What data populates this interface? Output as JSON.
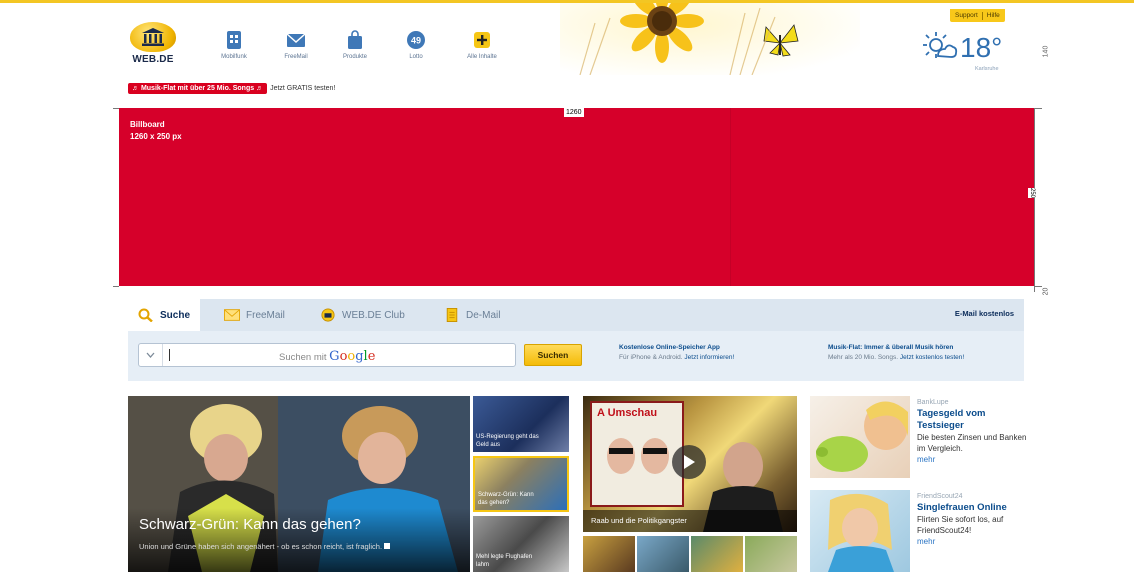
{
  "header": {
    "logo_text": "WEB.DE",
    "nav": [
      {
        "label": "Mobilfunk",
        "icon": "mobile-icon"
      },
      {
        "label": "FreeMail",
        "icon": "mail-icon"
      },
      {
        "label": "Produkte",
        "icon": "bag-icon"
      },
      {
        "label": "Lotto",
        "icon": "lotto-icon",
        "badge": "49"
      },
      {
        "label": "Alle Inhalte",
        "icon": "plus-icon"
      }
    ],
    "support_label": "Support",
    "help_label": "Hilfe",
    "weather": {
      "temp": "18°",
      "city": "Karlsruhe",
      "icon": "sun-cloud-icon"
    },
    "side_number": "140"
  },
  "promo": {
    "tag": "♬ Musik-Flat mit über 25 Mio. Songs ♬",
    "text": "Jetzt GRATIS testen!"
  },
  "billboard": {
    "title": "Billboard",
    "size": "1260 x 250 px",
    "width_label": "1260",
    "height_label": "250",
    "gap_label": "20"
  },
  "search": {
    "tabs": [
      {
        "label": "Suche",
        "icon": "search-icon"
      },
      {
        "label": "FreeMail",
        "icon": "mail-icon"
      },
      {
        "label": "WEB.DE Club",
        "icon": "club-icon"
      },
      {
        "label": "De-Mail",
        "icon": "demail-icon"
      }
    ],
    "email_link": "E-Mail kostenlos",
    "placeholder_prefix": "Suchen mit",
    "provider": [
      "G",
      "o",
      "o",
      "g",
      "l",
      "e"
    ],
    "button": "Suchen",
    "teasers": [
      {
        "headline": "Kostenlose Online-Speicher App",
        "sub": "Für iPhone & Android.",
        "link": "Jetzt informieren!"
      },
      {
        "headline": "Musik-Flat: Immer & überall Musik hören",
        "sub": "Mehr als 20 Mio. Songs.",
        "link": "Jetzt kostenlos testen!"
      }
    ]
  },
  "content": {
    "main_story": {
      "title": "Schwarz-Grün: Kann das gehen?",
      "desc": "Union und Grüne haben sich angenähert - ob es schon reicht, ist fraglich."
    },
    "side_stories": [
      {
        "caption": "US-Regierung geht das Geld aus"
      },
      {
        "caption": "Schwarz-Grün: Kann das gehen?"
      },
      {
        "caption": "Mehl legte Flughafen lahm"
      }
    ],
    "video": {
      "caption": "Raab und die Politikgangster",
      "poster_text": "A Umschau"
    },
    "ads": [
      {
        "source": "BankLupe",
        "headline": "Tagesgeld vom Testsieger",
        "body": "Die besten Zinsen und Banken im Vergleich.",
        "more": "mehr"
      },
      {
        "source": "FriendScout24",
        "headline": "Singlefrauen Online",
        "body": "Flirten Sie sofort los, auf FriendScout24!",
        "more": "mehr"
      }
    ]
  }
}
